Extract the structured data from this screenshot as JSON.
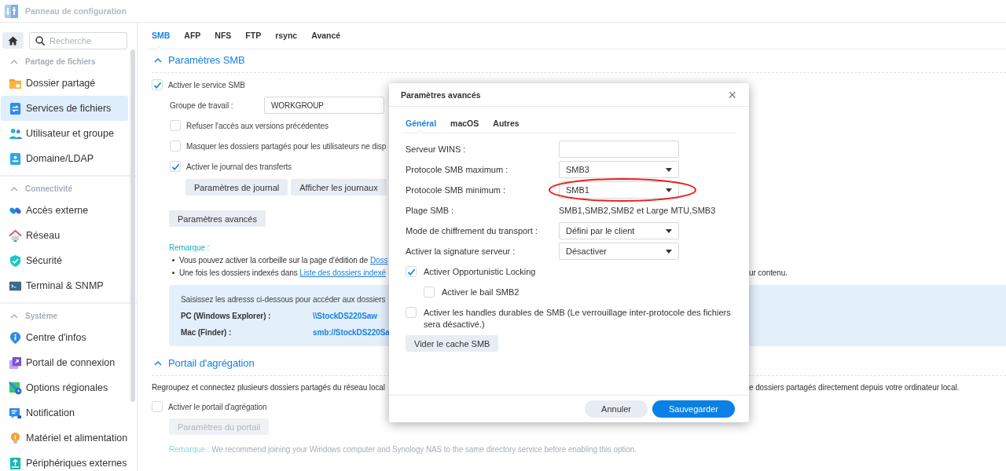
{
  "window": {
    "title": "Panneau de configuration"
  },
  "sidebar": {
    "search": {
      "placeholder": "Recherche"
    },
    "sections": [
      {
        "title": "Partage de fichiers",
        "expanded": true,
        "items": [
          {
            "label": "Dossier partagé",
            "selected": false
          },
          {
            "label": "Services de fichiers",
            "selected": true
          },
          {
            "label": "Utilisateur et groupe",
            "selected": false
          },
          {
            "label": "Domaine/LDAP",
            "selected": false
          }
        ]
      },
      {
        "title": "Connectivité",
        "expanded": true,
        "items": [
          {
            "label": "Accès externe",
            "selected": false
          },
          {
            "label": "Réseau",
            "selected": false
          },
          {
            "label": "Sécurité",
            "selected": false
          },
          {
            "label": "Terminal & SNMP",
            "selected": false
          }
        ]
      },
      {
        "title": "Système",
        "expanded": true,
        "items": [
          {
            "label": "Centre d'infos",
            "selected": false
          },
          {
            "label": "Portail de connexion",
            "selected": false
          },
          {
            "label": "Options régionales",
            "selected": false
          },
          {
            "label": "Notification",
            "selected": false
          },
          {
            "label": "Matériel et alimentation",
            "selected": false
          },
          {
            "label": "Périphériques externes",
            "selected": false
          }
        ]
      }
    ]
  },
  "tabs": [
    {
      "label": "SMB",
      "selected": true
    },
    {
      "label": "AFP",
      "selected": false
    },
    {
      "label": "NFS",
      "selected": false
    },
    {
      "label": "FTP",
      "selected": false
    },
    {
      "label": "rsync",
      "selected": false
    },
    {
      "label": "Avancé",
      "selected": false
    }
  ],
  "smb_section": {
    "title": "Paramètres SMB",
    "expanded": true,
    "enable": {
      "label": "Activer le service SMB",
      "checked": true
    },
    "workgroup": {
      "label": "Groupe de travail :",
      "value": "WORKGROUP"
    },
    "options": [
      {
        "label": "Refuser l'accès aux versions précédentes",
        "checked": false
      },
      {
        "label": "Masquer les dossiers partagés pour les utilisateurs ne disp",
        "checked": false
      },
      {
        "label": "Activer le journal des transferts",
        "checked": true
      }
    ],
    "log_buttons": [
      "Paramètres de journal",
      "Afficher les journaux"
    ],
    "advanced_button": "Paramètres avancés",
    "remark": {
      "title": "Remarque :",
      "bullets": [
        {
          "text": "Vous pouvez activer la corbeille sur la page d'édition de ",
          "link": "Doss"
        },
        {
          "text": "Une fois les dossiers indexés dans ",
          "link": "Liste des dossiers indexé",
          "tail": "ur contenu."
        }
      ]
    },
    "address_box": {
      "intro": "Saisissez les adresss ci-dessous pour accéder aux dossiers",
      "rows": [
        {
          "label": "PC (Windows Explorer) :",
          "value": "\\\\StockDS220Saw"
        },
        {
          "label": "Mac (Finder) :",
          "value": "smb://StockDS220Sa"
        }
      ]
    }
  },
  "aggregation_section": {
    "title": "Portail d'agrégation",
    "expanded": true,
    "description": "Regroupez et connectez plusieurs dossiers partagés du réseau local",
    "description_tail": "e dossiers partagés directement depuis votre ordinateur local.",
    "enable": {
      "label": "Activer le portail d'agrégation",
      "checked": false
    },
    "portal_button": {
      "label": "Paramètres du portail",
      "disabled": true
    },
    "remark": {
      "title": "Remarque :",
      "text": "We recommend joining your Windows computer and Synology NAS to the same directory service before enabling this option."
    }
  },
  "dialog": {
    "title": "Paramètres avancés",
    "close": "×",
    "tabs": [
      {
        "label": "Général",
        "selected": true
      },
      {
        "label": "macOS",
        "selected": false
      },
      {
        "label": "Autres",
        "selected": false
      }
    ],
    "fields": [
      {
        "kind": "input",
        "label": "Serveur WINS :"
      },
      {
        "kind": "select",
        "label": "Protocole SMB maximum :",
        "value": "SMB3",
        "highlighted": false
      },
      {
        "kind": "select",
        "label": "Protocole SMB minimum :",
        "value": "SMB1",
        "highlighted": true
      },
      {
        "kind": "text",
        "label": "Plage SMB :",
        "value": "SMB1,SMB2,SMB2 et Large MTU,SMB3"
      },
      {
        "kind": "select",
        "label": "Mode de chiffrement du transport :",
        "value": "Défini par le client",
        "highlighted": false
      },
      {
        "kind": "select",
        "label": "Activer la signature serveur :",
        "value": "Désactiver",
        "highlighted": false
      }
    ],
    "checkboxes": [
      {
        "label": "Activer Opportunistic Locking",
        "checked": true,
        "children": [
          {
            "label": "Activer le bail SMB2",
            "checked": false
          }
        ]
      },
      {
        "label": "Activer les handles durables de SMB (Le verrouillage inter-protocole des fichiers sera désactivé.)",
        "checked": false
      }
    ],
    "clear_cache_button": "Vider le cache SMB",
    "buttons": [
      {
        "label": "Annuler",
        "kind": "secondary"
      },
      {
        "label": "Sauvegarder",
        "kind": "primary"
      }
    ]
  }
}
